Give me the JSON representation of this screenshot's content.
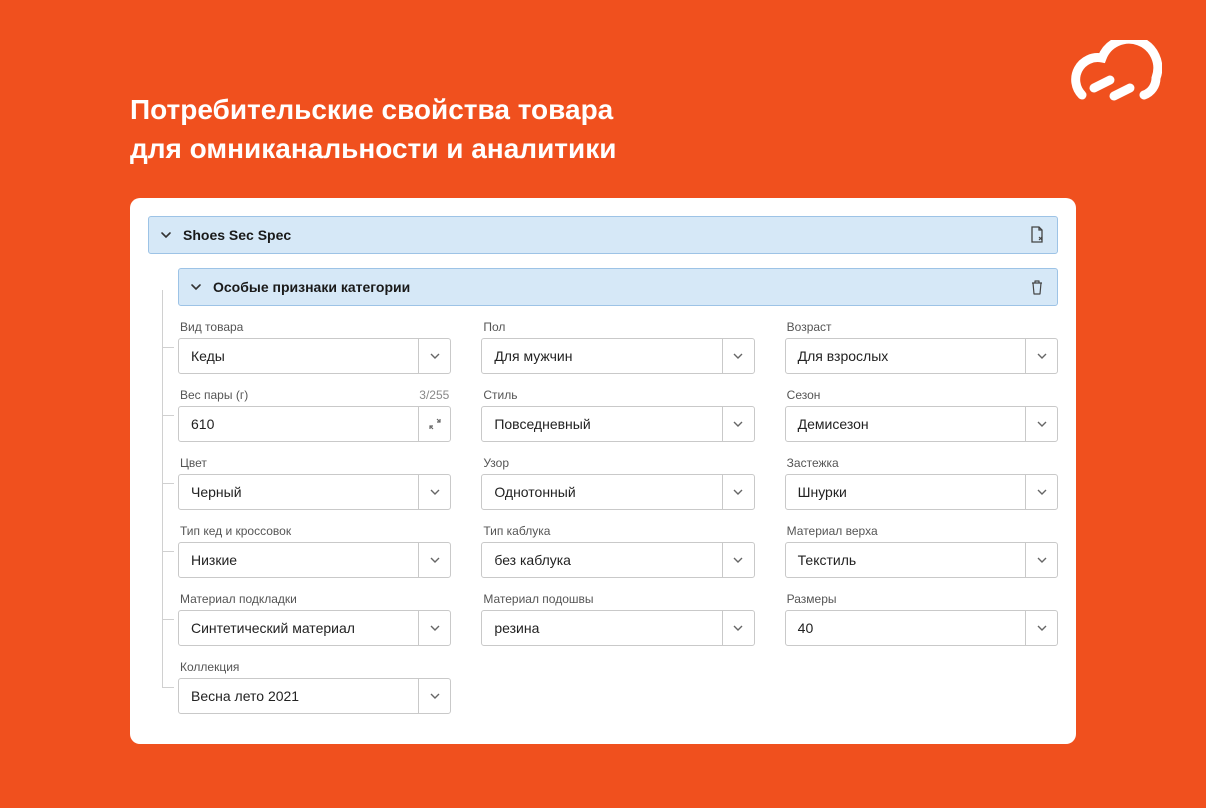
{
  "heading_line1": "Потребительские свойства товара",
  "heading_line2": "для омниканальности и аналитики",
  "section_title": "Shoes Sec Spec",
  "sub_section_title": "Особые признаки категории",
  "fields": {
    "product_type": {
      "label": "Вид товара",
      "value": "Кеды"
    },
    "gender": {
      "label": "Пол",
      "value": "Для мужчин"
    },
    "age": {
      "label": "Возраст",
      "value": "Для взрослых"
    },
    "weight": {
      "label": "Вес пары (г)",
      "value": "610",
      "counter": "3/255"
    },
    "style": {
      "label": "Стиль",
      "value": "Повседневный"
    },
    "season": {
      "label": "Сезон",
      "value": "Демисезон"
    },
    "color": {
      "label": "Цвет",
      "value": "Черный"
    },
    "pattern": {
      "label": "Узор",
      "value": "Однотонный"
    },
    "fastener": {
      "label": "Застежка",
      "value": "Шнурки"
    },
    "sneaker_type": {
      "label": "Тип кед и кроссовок",
      "value": "Низкие"
    },
    "heel_type": {
      "label": "Тип каблука",
      "value": "без каблука"
    },
    "upper_material": {
      "label": "Материал верха",
      "value": "Текстиль"
    },
    "lining_material": {
      "label": "Материал подкладки",
      "value": "Синтетический материал"
    },
    "sole_material": {
      "label": "Материал подошвы",
      "value": "резина"
    },
    "sizes": {
      "label": "Размеры",
      "value": "40"
    },
    "collection": {
      "label": "Коллекция",
      "value": "Весна лето 2021"
    }
  }
}
